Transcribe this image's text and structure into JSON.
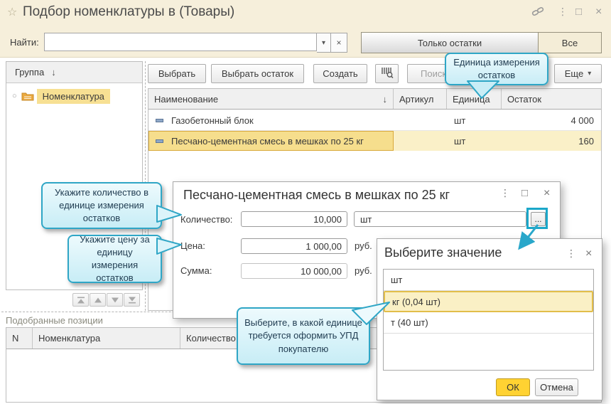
{
  "titlebar": {
    "title": "Подбор номенклатуры в (Товары)"
  },
  "glyphs": {
    "star": "☆",
    "menu": "⋮",
    "maximize": "□",
    "close": "×",
    "combo": "▾",
    "clear": "×",
    "sort": "↓",
    "circle": "○",
    "ellipsis": "...",
    "more_arrow": "▾"
  },
  "searchbar": {
    "label": "Найти:",
    "value": "",
    "only_rest": "Только остатки",
    "all": "Все"
  },
  "group_panel": {
    "header": "Группа",
    "item": "Номенклатура"
  },
  "toolbar": {
    "select": "Выбрать",
    "select_rest": "Выбрать остаток",
    "create": "Создать",
    "search": "Поиск",
    "more": "Еще"
  },
  "items_table": {
    "headers": {
      "name": "Наименование",
      "article": "Артикул",
      "unit": "Единица",
      "rest": "Остаток"
    },
    "rows": [
      {
        "name": "Газобетонный блок",
        "article": "",
        "unit": "шт",
        "rest": "4 000"
      },
      {
        "name": "Песчано-цементная смесь в мешках по 25 кг",
        "article": "",
        "unit": "шт",
        "rest": "160"
      }
    ]
  },
  "picked_panel": {
    "label": "Подобранные позиции",
    "headers": {
      "n": "N",
      "name": "Номенклатура",
      "qty": "Количество"
    }
  },
  "qty_dialog": {
    "title": "Песчано-цементная смесь в мешках по 25 кг",
    "qty_label": "Количество:",
    "qty_value": "10,000",
    "qty_unit": "шт",
    "price_label": "Цена:",
    "price_value": "1 000,00",
    "price_suffix": "руб.",
    "sum_label": "Сумма:",
    "sum_value": "10 000,00",
    "sum_suffix": "руб."
  },
  "value_dialog": {
    "title": "Выберите значение",
    "options": [
      "шт",
      "кг (0,04 шт)",
      "т (40 шт)"
    ],
    "selected_index": 1,
    "ok": "ОК",
    "cancel": "Отмена"
  },
  "callouts": {
    "unit": "Единица измерения остатков",
    "qty": "Укажите количество в единице измерения остатков",
    "price": "Укажите цену за единицу измерения остатков",
    "upd": "Выберите, в какой единице требуется оформить УПД покупателю"
  }
}
